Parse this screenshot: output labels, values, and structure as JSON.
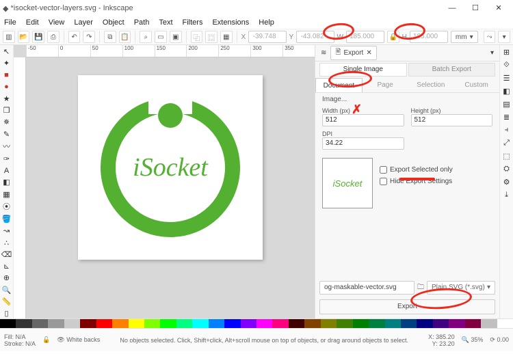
{
  "window": {
    "title": "*isocket-vector-layers.svg - Inkscape"
  },
  "menu": [
    "File",
    "Edit",
    "View",
    "Layer",
    "Object",
    "Path",
    "Text",
    "Filters",
    "Extensions",
    "Help"
  ],
  "top": {
    "x_label": "X",
    "x": "-39.748",
    "y_label": "Y",
    "y": "-43.082",
    "w_label": "W",
    "w": "185.000",
    "h_label": "H",
    "h": "185.000",
    "unit": "mm"
  },
  "ruler": [
    "-50",
    "0",
    "50",
    "100",
    "150",
    "200",
    "250",
    "300",
    "350"
  ],
  "logo_text": "iSocket",
  "export": {
    "panel_title": "Export",
    "subtabs": [
      "Single Image",
      "Batch Export"
    ],
    "tabs": [
      "Document",
      "Page",
      "Selection",
      "Custom"
    ],
    "section": "Image...",
    "width_label": "Width (px)",
    "width_val": "512",
    "height_label": "Height (px)",
    "height_val": "512",
    "dpi_label": "DPI",
    "dpi_val": "34.22",
    "chk_selected": "Export Selected only",
    "chk_hide": "Hide Export Settings",
    "filename": "og-maskable-vector.svg",
    "format": "Plain SVG (*.svg)",
    "button": "Export"
  },
  "status": {
    "fill_label": "Fill:",
    "fill_val": "N/A",
    "stroke_label": "Stroke:",
    "stroke_val": "N/A",
    "layer": "White backs",
    "hint": "No objects selected. Click, Shift+click, Alt+scroll mouse on top of objects, or drag around objects to select.",
    "coords_x": "X: 385.20",
    "coords_y": "Y: 23.20",
    "zoom": "35%",
    "rot": "0.00"
  },
  "palette": [
    "#000",
    "#333",
    "#666",
    "#999",
    "#ccc",
    "#800000",
    "#f00",
    "#ff8000",
    "#ff0",
    "#80ff00",
    "#0f0",
    "#00ff80",
    "#0ff",
    "#0080ff",
    "#00f",
    "#8000ff",
    "#f0f",
    "#ff0080",
    "#400000",
    "#804000",
    "#808000",
    "#408000",
    "#008000",
    "#008040",
    "#008080",
    "#004080",
    "#000080",
    "#400080",
    "#800080",
    "#800040",
    "#c0c0c0",
    "#fff"
  ]
}
